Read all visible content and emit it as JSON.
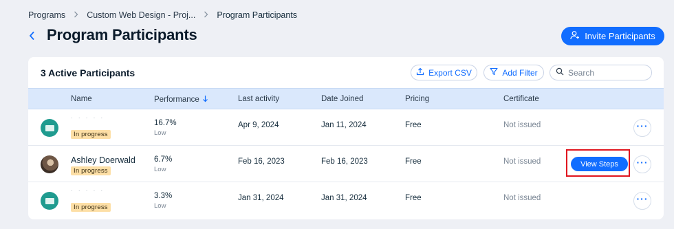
{
  "breadcrumb": {
    "items": [
      "Programs",
      "Custom Web Design - Proj...",
      "Program Participants"
    ]
  },
  "page": {
    "title": "Program Participants",
    "invite_label": "Invite Participants"
  },
  "card": {
    "title": "3 Active Participants",
    "export_label": "Export CSV",
    "filter_label": "Add Filter",
    "search_placeholder": "Search"
  },
  "table": {
    "columns": [
      "Name",
      "Performance",
      "Last activity",
      "Date Joined",
      "Pricing",
      "Certificate"
    ],
    "sort_column": "Performance",
    "rows": [
      {
        "name": "· · · · ·",
        "status": "In progress",
        "performance": "16.7%",
        "performance_level": "Low",
        "last_activity": "Apr 9, 2024",
        "date_joined": "Jan 11, 2024",
        "pricing": "Free",
        "certificate": "Not issued",
        "avatar": "default"
      },
      {
        "name": "Ashley Doerwald",
        "status": "In progress",
        "performance": "6.7%",
        "performance_level": "Low",
        "last_activity": "Feb 16, 2023",
        "date_joined": "Feb 16, 2023",
        "pricing": "Free",
        "certificate": "Not issued",
        "avatar": "photo",
        "action_label": "View Steps"
      },
      {
        "name": "· · · · ·",
        "status": "In progress",
        "performance": "3.3%",
        "performance_level": "Low",
        "last_activity": "Jan 31, 2024",
        "date_joined": "Jan 31, 2024",
        "pricing": "Free",
        "certificate": "Not issued",
        "avatar": "default"
      }
    ],
    "more_label": "···"
  },
  "colors": {
    "accent": "#116dff",
    "header_bg": "#dae8fc",
    "badge_bg": "#fddfa6",
    "highlight": "#e0151f"
  }
}
